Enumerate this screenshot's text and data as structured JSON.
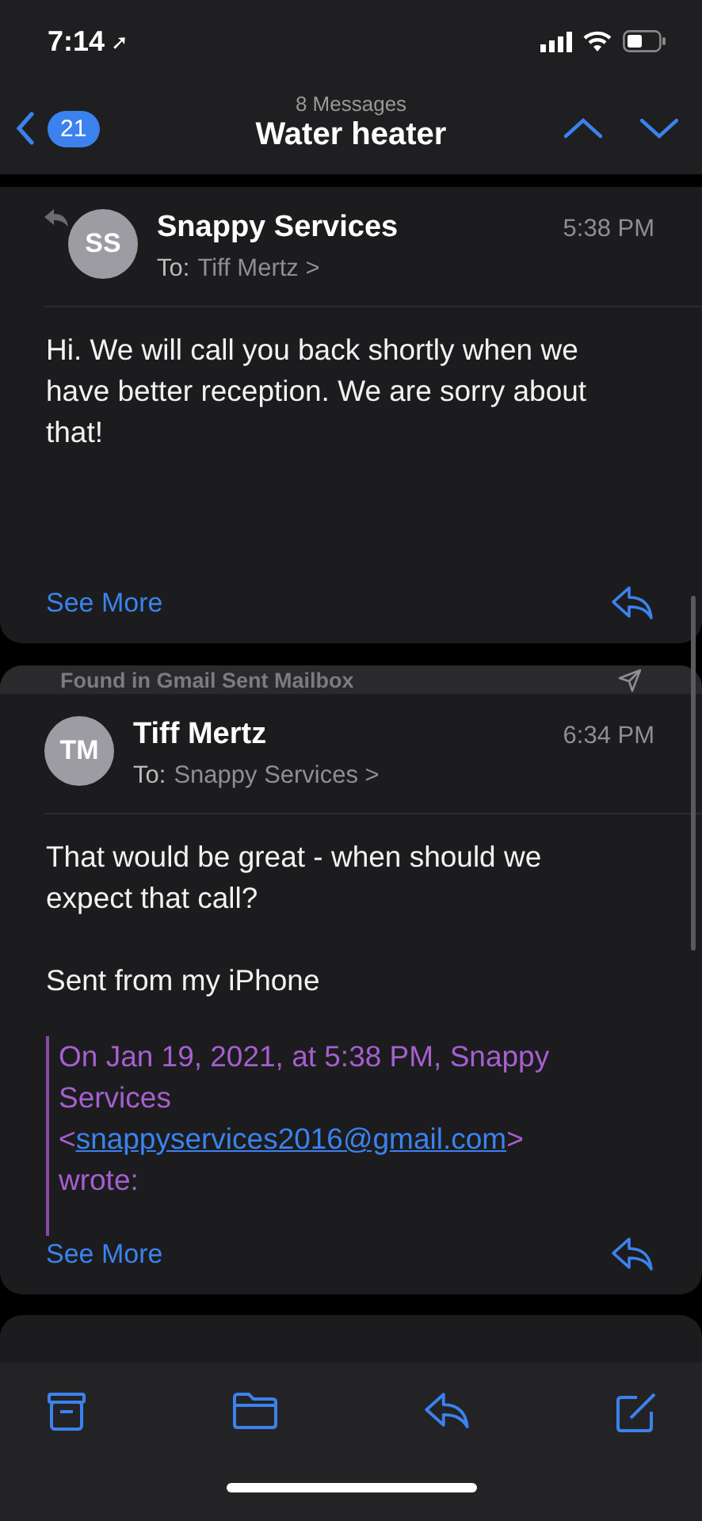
{
  "status_bar": {
    "time": "7:14",
    "location_arrow": "➚"
  },
  "nav": {
    "unread_count": "21",
    "subtitle": "8 Messages",
    "title": "Water heater"
  },
  "messages": [
    {
      "initials": "SS",
      "sender": "Snappy Services",
      "to_label": "To:",
      "recipient": "Tiff Mertz",
      "chevron": ">",
      "time": "5:38 PM",
      "replied": true,
      "paragraphs": [
        "Hi. We will call you back shortly when we have better reception. We are sorry about that!"
      ],
      "see_more": "See More"
    },
    {
      "initials": "TM",
      "sender": "Tiff Mertz",
      "to_label": "To:",
      "recipient": "Snappy Services",
      "chevron": ">",
      "time": "6:34 PM",
      "replied": false,
      "found_in": "Found in Gmail Sent Mailbox",
      "paragraphs": [
        "That would be great - when should we expect that call?",
        "Sent from my iPhone"
      ],
      "quote": {
        "intro": "On Jan 19, 2021, at 5:38 PM, Snappy Services <",
        "link": "snappyservices2016@gmail.com",
        "outro": "> wrote:"
      },
      "see_more": "See More"
    }
  ]
}
